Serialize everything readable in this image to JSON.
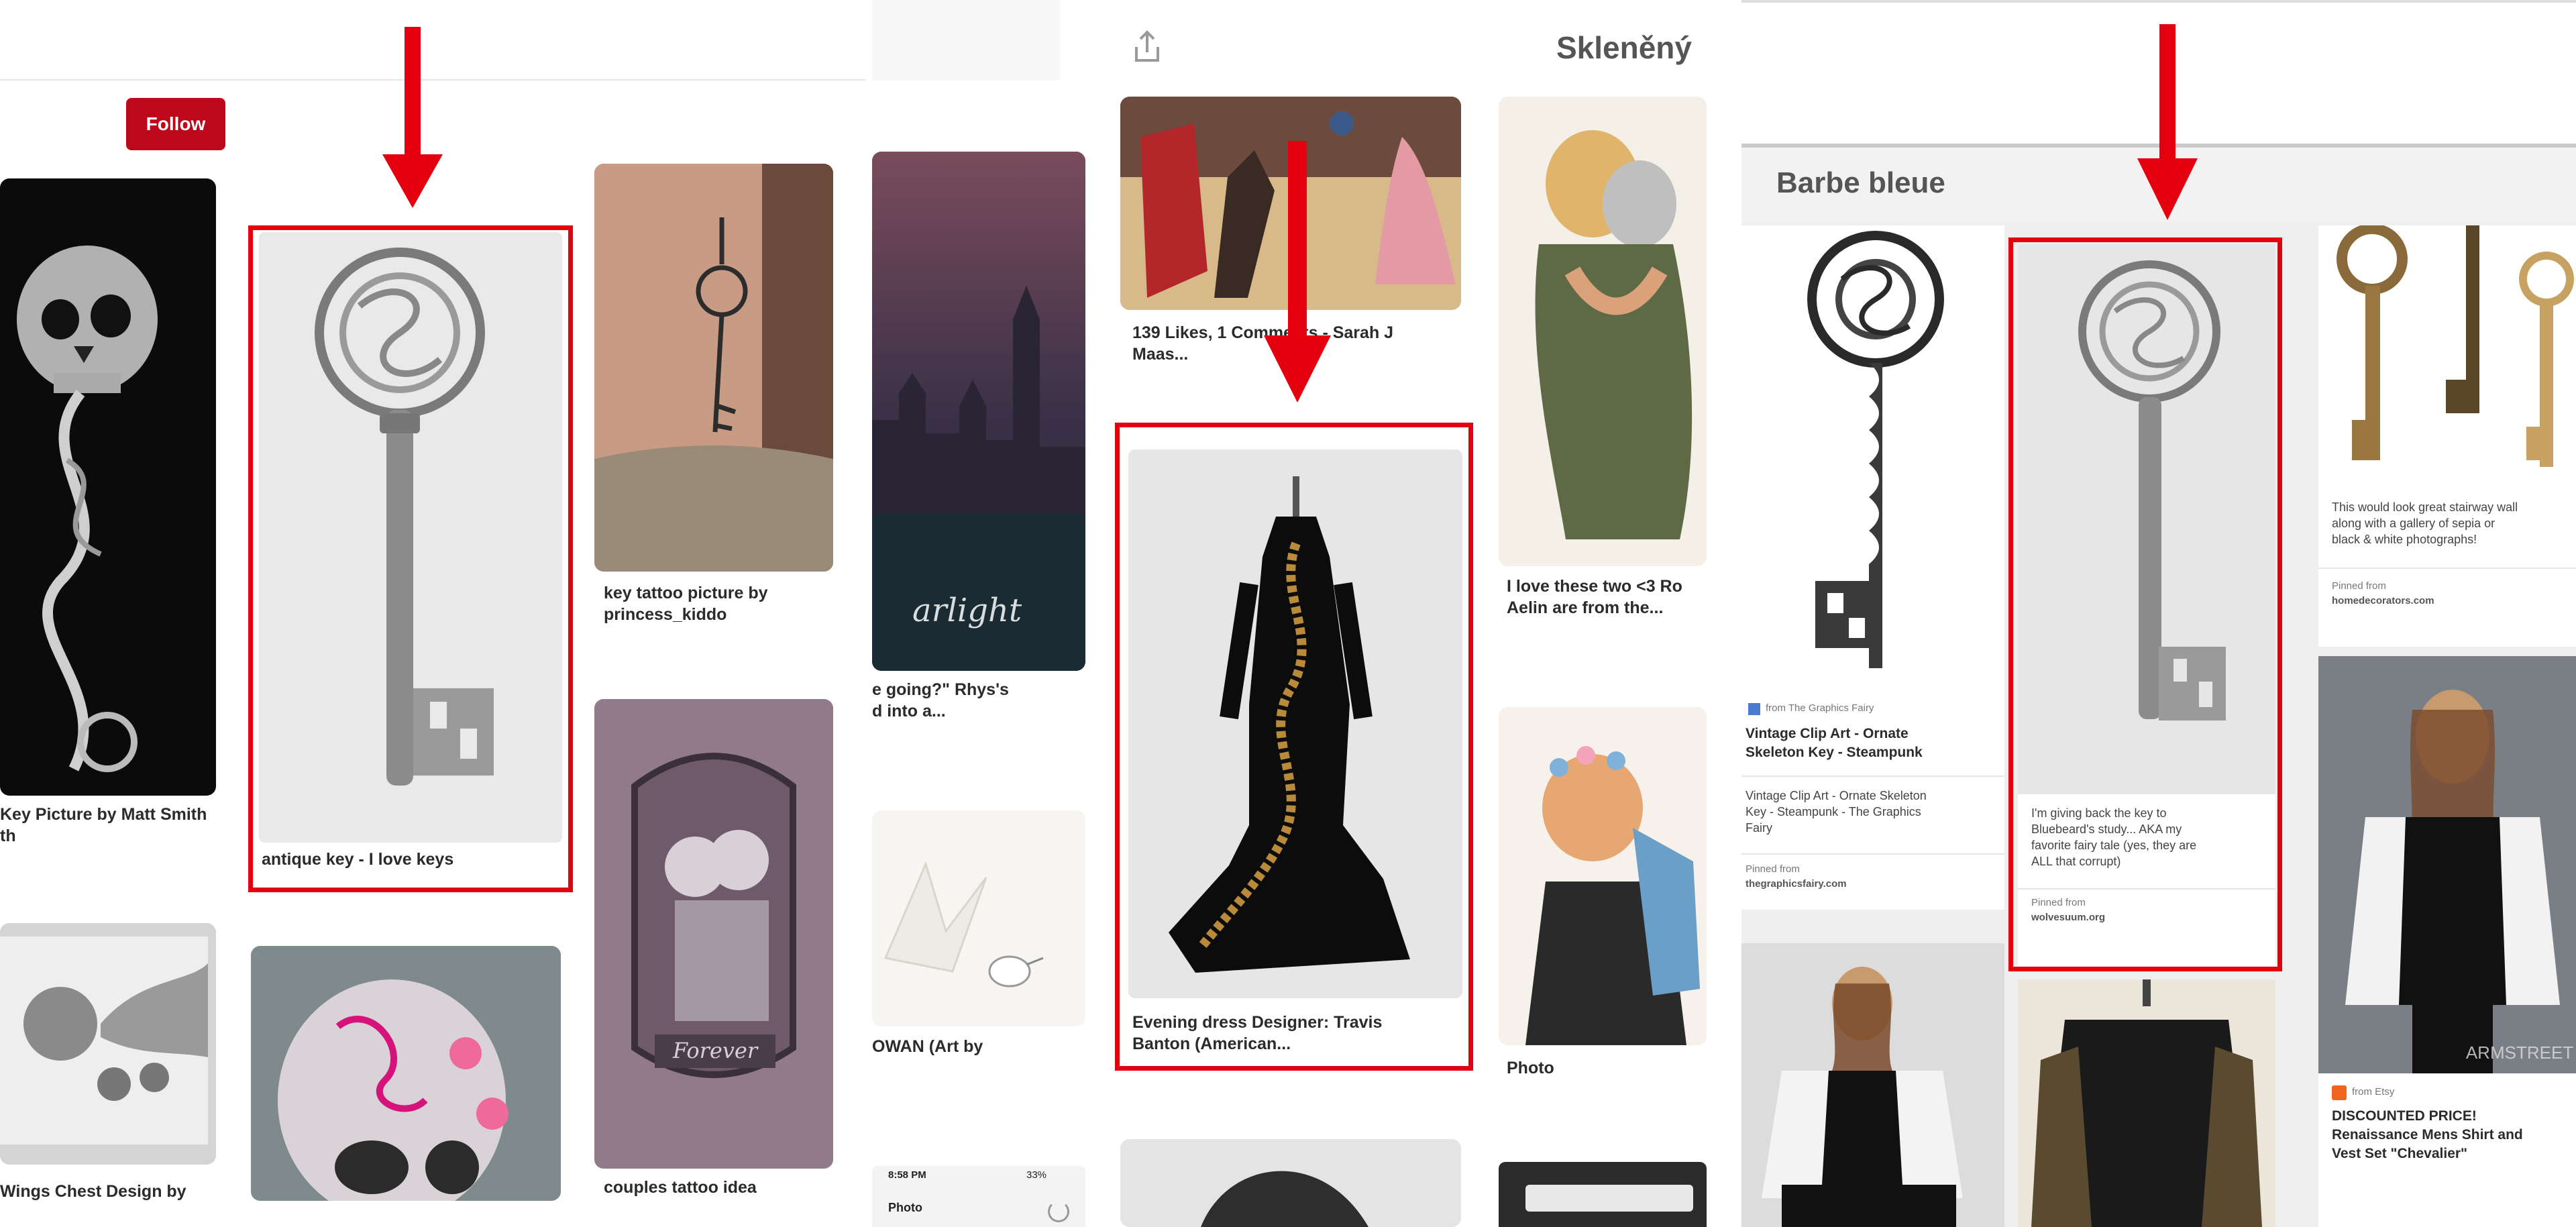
{
  "panel1": {
    "follow_label": "Follow",
    "pin1_caption": "Key Picture by Matt Smith\nth",
    "pin2_caption": "antique key - I love keys",
    "pin3_caption": "key tattoo picture by\nprincess_kiddo",
    "pin4_caption": "couples tattoo idea",
    "pin5_caption": "Wings Chest Design by",
    "tattoo_text": "Forever"
  },
  "panel2": {
    "title": "Skleněný",
    "pin1_caption": "e going?\" Rhys's\nd into a...",
    "pin1_overlay": "arlight",
    "pin2_caption": "OWAN (Art by",
    "pin3_caption": "139 Likes, 1 Comments - Sarah J\nMaas...",
    "pin4_caption": "Evening dress Designer: Travis\nBanton (American...",
    "pin5_caption": "I love these two <3 Ro\nAelin are from the...",
    "pin6_caption": "Photo",
    "phone_status": "8:58 PM",
    "phone_battery": "33%",
    "phone_title": "Photo"
  },
  "panel3": {
    "board_title": "Barbe bleue",
    "pin1_source": "from The Graphics Fairy",
    "pin1_title": "Vintage Clip Art - Ornate\nSkeleton Key - Steampunk",
    "pin1_desc": "Vintage Clip Art - Ornate Skeleton\nKey - Steampunk - The Graphics\nFairy",
    "pin1_pinned": "Pinned from",
    "pin1_domain": "thegraphicsfairy.com",
    "pin2_desc": "I'm giving back the key to\nBluebeard's study... AKA my\nfavorite fairy tale (yes, they are\nALL that corrupt)",
    "pin2_pinned": "Pinned from",
    "pin2_domain": "wolvesuum.org",
    "pin3_desc": "This would look great stairway wall\nalong with a gallery of sepia or\nblack & white photographs!",
    "pin3_pinned": "Pinned from",
    "pin3_domain": "homedecorators.com",
    "pin4_source": "from Etsy",
    "pin4_title": "DISCOUNTED PRICE!\nRenaissance Mens Shirt and\nVest Set \"Chevalier\"",
    "watermark": "ARMSTREET"
  },
  "colors": {
    "highlight": "#e4000f",
    "follow_bg": "#bd081c"
  }
}
